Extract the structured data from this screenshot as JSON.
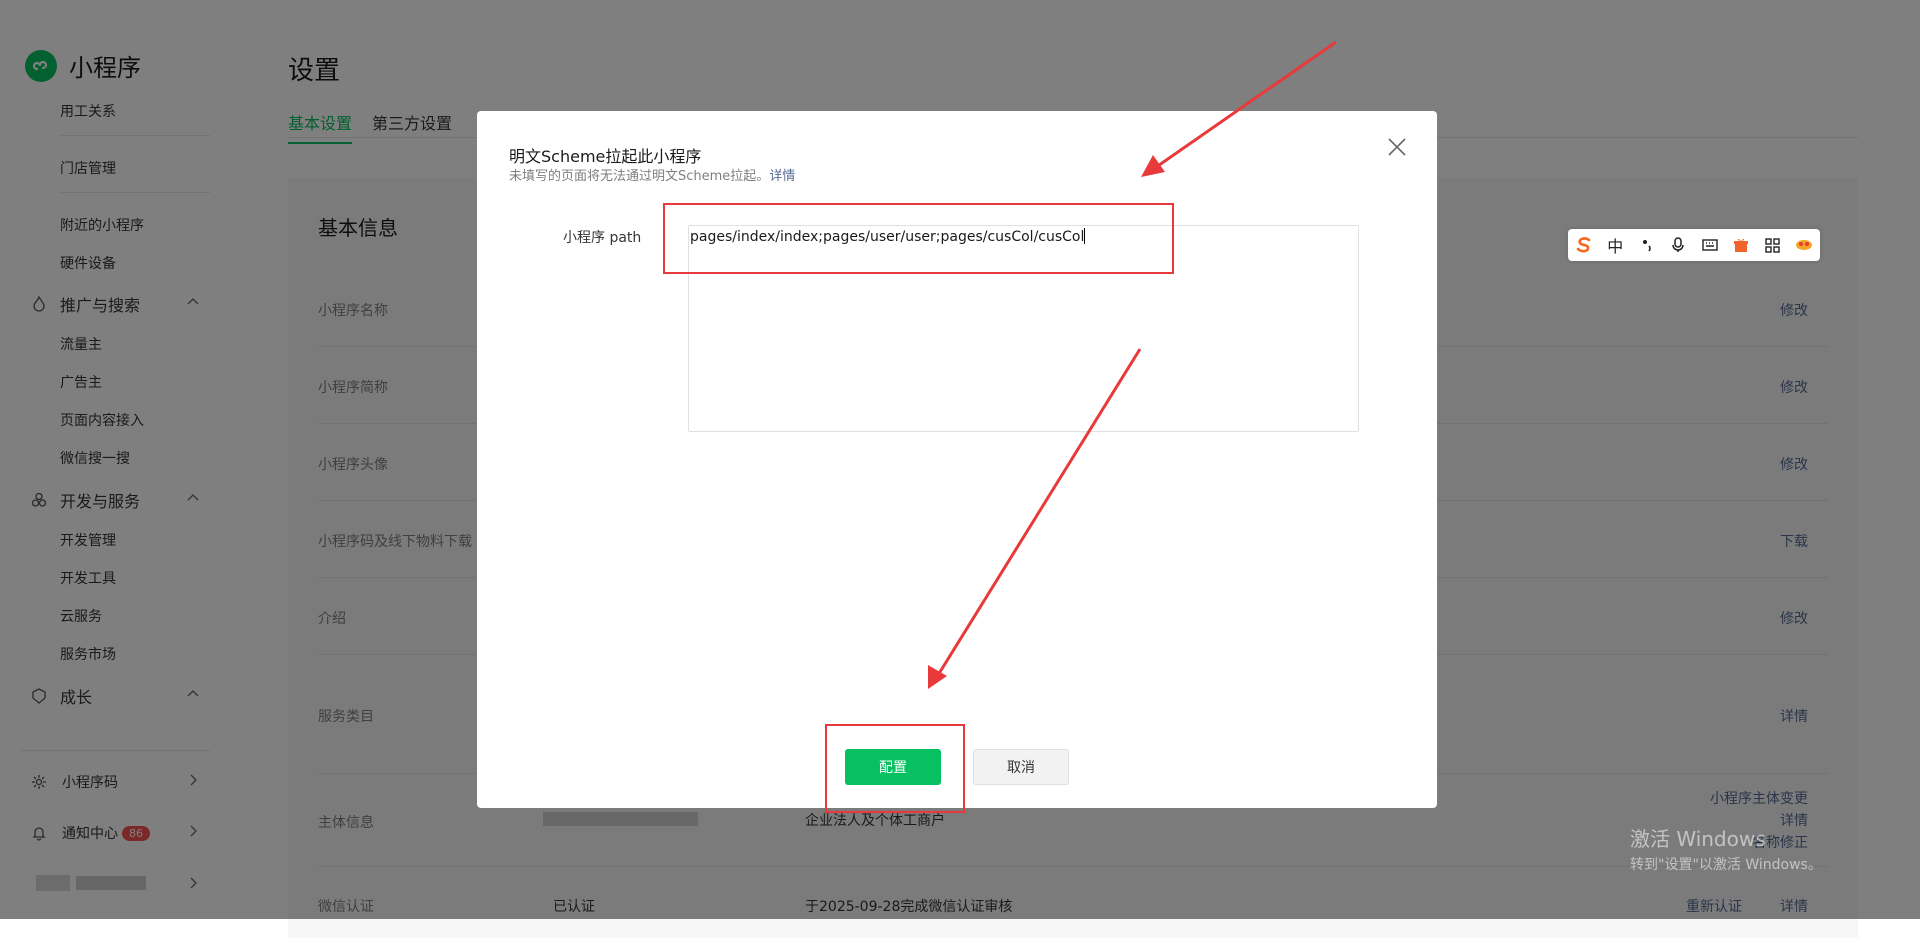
{
  "app": {
    "title": "小程序"
  },
  "sidebar": {
    "items_top": [
      "用工关系",
      "门店管理",
      "附近的小程序",
      "硬件设备"
    ],
    "promo": {
      "label": "推广与搜索",
      "items": [
        "流量主",
        "广告主",
        "页面内容接入",
        "微信搜一搜"
      ]
    },
    "dev": {
      "label": "开发与服务",
      "items": [
        "开发管理",
        "开发工具",
        "云服务",
        "服务市场"
      ]
    },
    "growth": {
      "label": "成长"
    },
    "qrcode": {
      "label": "小程序码"
    },
    "notify": {
      "label": "通知中心",
      "count": "86"
    }
  },
  "page": {
    "title": "设置",
    "tabs": [
      "基本设置",
      "第三方设置"
    ],
    "card_title": "基本信息",
    "rows": [
      {
        "label": "小程序名称",
        "action": "修改"
      },
      {
        "label": "小程序简称",
        "action": "修改"
      },
      {
        "label": "小程序头像",
        "action": "修改"
      },
      {
        "label": "小程序码及线下物料下载",
        "action": "下载"
      },
      {
        "label": "介绍",
        "action": "修改"
      },
      {
        "label": "服务类目",
        "action": "详情"
      },
      {
        "label": "主体信息",
        "value": "企业法人及个体工商户",
        "actions": [
          "小程序主体变更",
          "详情",
          "名称修正"
        ]
      },
      {
        "label": "微信认证",
        "status": "已认证",
        "value": "于2025-09-28完成微信认证审核",
        "actions": [
          "重新认证",
          "详情"
        ]
      }
    ]
  },
  "modal": {
    "title": "明文Scheme拉起此小程序",
    "subtitle": "未填写的页面将无法通过明文Scheme拉起。",
    "detail_link": "详情",
    "field_label": "小程序 path",
    "path_value": "pages/index/index;pages/user/user;pages/cusCol/cusCol",
    "confirm_label": "配置",
    "cancel_label": "取消"
  },
  "ime": {
    "icons": [
      "sogou-logo-icon",
      "中",
      "punctuation-icon",
      "microphone-icon",
      "keyboard-icon",
      "gift-icon",
      "grid-icon",
      "skin-icon"
    ]
  },
  "watermark": {
    "line1": "激活 Windows",
    "line2": "转到\"设置\"以激活 Windows。"
  },
  "colors": {
    "accent": "#07c160",
    "link": "#576b95",
    "annotation": "#e83a3a",
    "badge": "#fa5151"
  }
}
